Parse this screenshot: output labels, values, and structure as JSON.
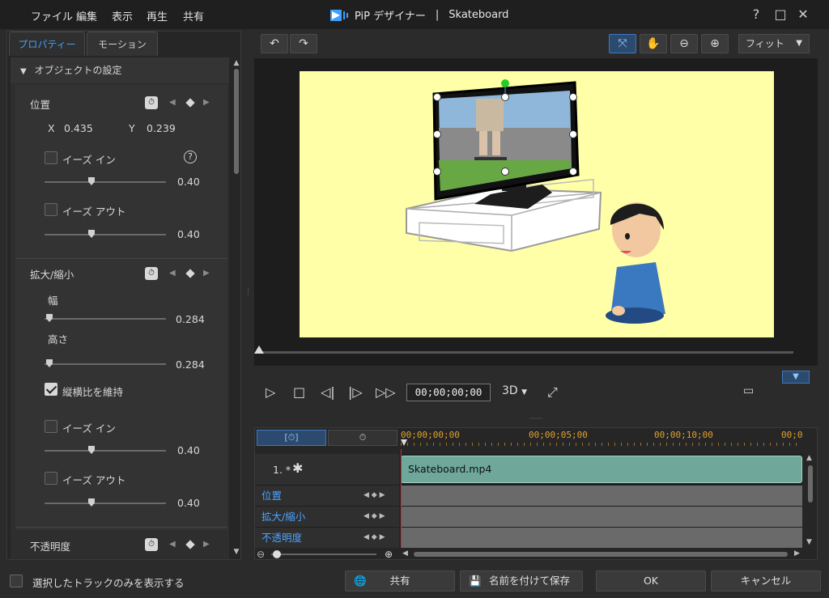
{
  "app": {
    "title_prefix": "PiP デザイナー",
    "separator": "|",
    "project_name": "Skateboard"
  },
  "menu": [
    "ファイル",
    "編集",
    "表示",
    "再生",
    "共有"
  ],
  "window_buttons": {
    "help": "?",
    "maximize": "□",
    "close": "✕"
  },
  "tabs": {
    "properties": "プロパティー",
    "motion": "モーション"
  },
  "object_settings": {
    "header": "オブジェクトの設定",
    "position": {
      "label": "位置",
      "x_label": "X",
      "x_value": "0.435",
      "y_label": "Y",
      "y_value": "0.239",
      "ease_in_label": "イーズ イン",
      "ease_in_value": "0.40",
      "ease_out_label": "イーズ アウト",
      "ease_out_value": "0.40"
    },
    "scale": {
      "label": "拡大/縮小",
      "width_label": "幅",
      "width_value": "0.284",
      "height_label": "高さ",
      "height_value": "0.284",
      "keep_aspect_label": "縦横比を維持",
      "ease_in_label": "イーズ イン",
      "ease_in_value": "0.40",
      "ease_out_label": "イーズ アウト",
      "ease_out_value": "0.40"
    },
    "opacity": {
      "label": "不透明度"
    }
  },
  "preview": {
    "fit_label": "フィット",
    "timecode": "00;00;00;00",
    "three_d_label": "3D"
  },
  "timeline": {
    "ruler": [
      "00;00;00;00",
      "00;00;05;00",
      "00;00;10;00",
      "00;0"
    ],
    "track_name": "1. *",
    "clip_name": "Skateboard.mp4",
    "rows": [
      "位置",
      "拡大/縮小",
      "不透明度"
    ]
  },
  "bottom": {
    "show_selected_label": "選択したトラックのみを表示する",
    "share": "共有",
    "save_as": "名前を付けて保存",
    "ok": "OK",
    "cancel": "キャンセル"
  }
}
